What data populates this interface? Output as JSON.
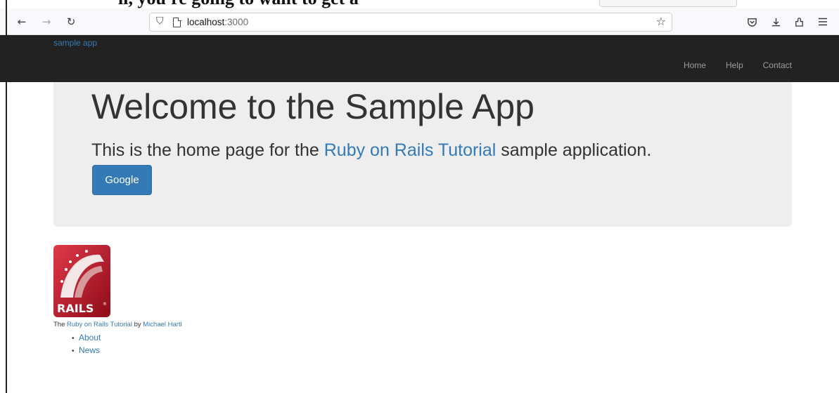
{
  "browser": {
    "cutoff_text": "ll, you're going to want to get a",
    "url_host": "localhost",
    "url_port": ":3000"
  },
  "navbar": {
    "logo": "sample app",
    "links": [
      "Home",
      "Help",
      "Contact"
    ]
  },
  "jumbotron": {
    "heading": "Welcome to the Sample App",
    "text_before": "This is the home page for the ",
    "link_text": "Ruby on Rails Tutorial",
    "text_after": " sample application.",
    "button_label": "Google"
  },
  "logo_image": {
    "wordmark": "RAILS",
    "mark": "®"
  },
  "footer": {
    "prefix": "The ",
    "tutorial_link": "Ruby on Rails Tutorial",
    "by": " by ",
    "author_link": "Michael Hartl",
    "links": [
      "About",
      "News"
    ]
  },
  "colors": {
    "link": "#337ab7",
    "navbar_bg": "#222222",
    "jumbotron_bg": "#eeeeee",
    "button_bg": "#337ab7",
    "rails_red": "#b6121f"
  },
  "icons": [
    "back-icon",
    "forward-icon",
    "reload-icon",
    "shield-icon",
    "page-icon",
    "bookmark-star-icon",
    "pocket-icon",
    "download-icon",
    "extensions-icon",
    "menu-icon"
  ]
}
